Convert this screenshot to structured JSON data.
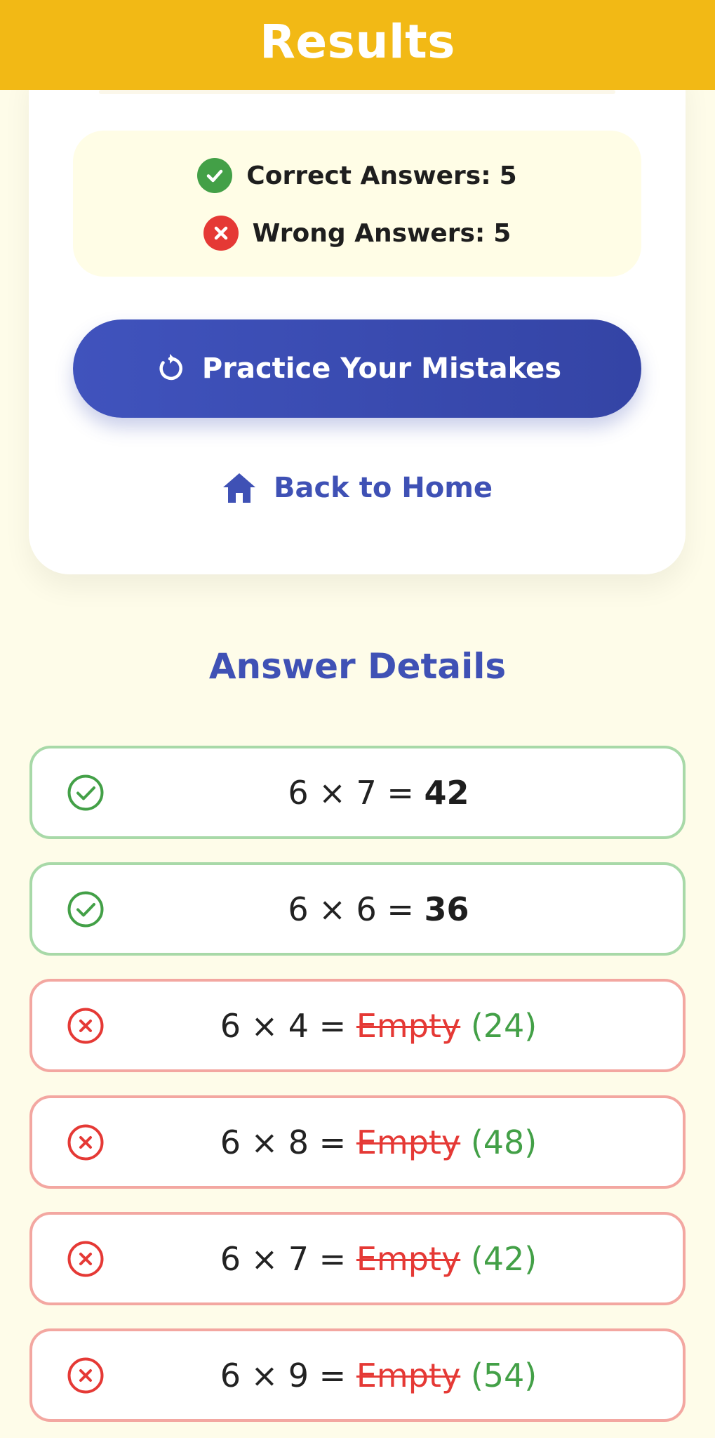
{
  "header": {
    "title": "Results"
  },
  "summary": {
    "correct_label": "Correct Answers:",
    "correct_count": "5",
    "wrong_label": "Wrong Answers:",
    "wrong_count": "5"
  },
  "actions": {
    "practice_label": "Practice Your Mistakes",
    "home_label": "Back to Home"
  },
  "details": {
    "title": "Answer Details",
    "items": [
      {
        "status": "correct",
        "question": "6 × 7 =",
        "given": "42",
        "expected": ""
      },
      {
        "status": "correct",
        "question": "6 × 6 =",
        "given": "36",
        "expected": ""
      },
      {
        "status": "wrong",
        "question": "6 × 4 =",
        "given": "Empty",
        "expected": "(24)"
      },
      {
        "status": "wrong",
        "question": "6 × 8 =",
        "given": "Empty",
        "expected": "(48)"
      },
      {
        "status": "wrong",
        "question": "6 × 7 =",
        "given": "Empty",
        "expected": "(42)"
      },
      {
        "status": "wrong",
        "question": "6 × 9 =",
        "given": "Empty",
        "expected": "(54)"
      }
    ]
  },
  "colors": {
    "header": "#f2b915",
    "primary": "#3f51b5",
    "correct": "#43a047",
    "wrong": "#e53935",
    "background": "#fefce9"
  },
  "icons": {
    "correct": "check-circle-icon",
    "wrong": "x-circle-icon",
    "retry": "refresh-icon",
    "home": "home-icon"
  }
}
